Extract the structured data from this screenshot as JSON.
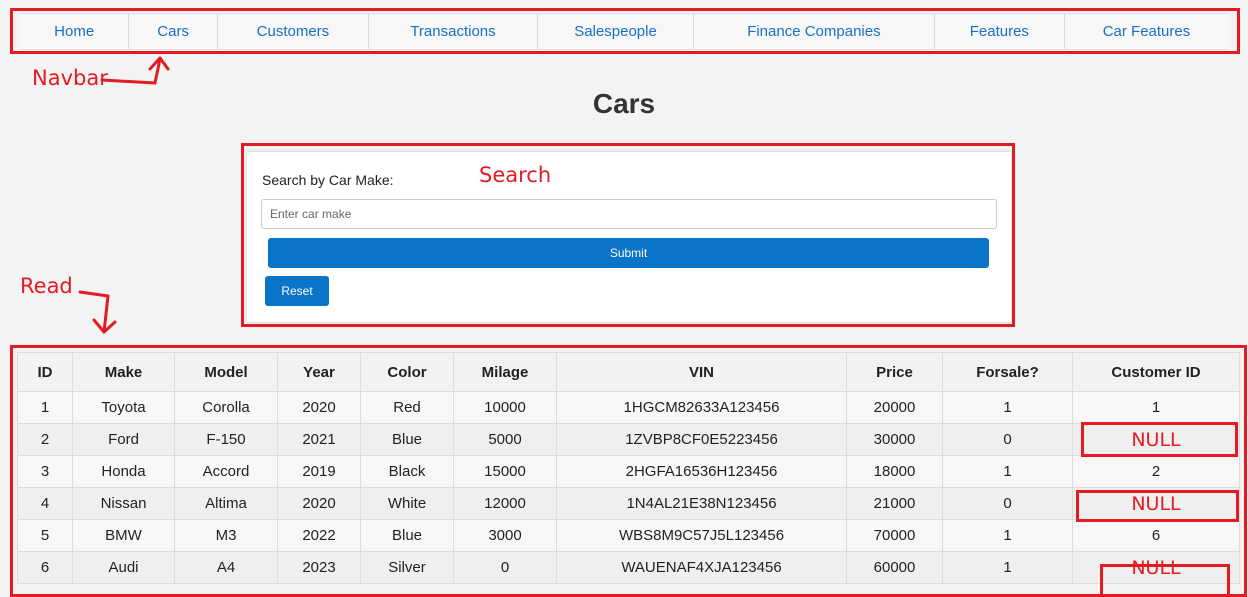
{
  "navbar": {
    "items": [
      {
        "label": "Home"
      },
      {
        "label": "Cars"
      },
      {
        "label": "Customers"
      },
      {
        "label": "Transactions"
      },
      {
        "label": "Salespeople"
      },
      {
        "label": "Finance Companies"
      },
      {
        "label": "Features"
      },
      {
        "label": "Car Features"
      }
    ]
  },
  "annotations": {
    "navbar": "Navbar",
    "search": "Search",
    "read": "Read",
    "null_label": "NULL",
    "color": "#e31b23"
  },
  "page": {
    "title": "Cars"
  },
  "search": {
    "label": "Search by Car Make:",
    "placeholder": "Enter car make",
    "submit_label": "Submit",
    "reset_label": "Reset"
  },
  "table": {
    "columns": [
      "ID",
      "Make",
      "Model",
      "Year",
      "Color",
      "Milage",
      "VIN",
      "Price",
      "Forsale?",
      "Customer ID"
    ],
    "rows": [
      [
        "1",
        "Toyota",
        "Corolla",
        "2020",
        "Red",
        "10000",
        "1HGCM82633A123456",
        "20000",
        "1",
        "1"
      ],
      [
        "2",
        "Ford",
        "F-150",
        "2021",
        "Blue",
        "5000",
        "1ZVBP8CF0E5223456",
        "30000",
        "0",
        "NULL"
      ],
      [
        "3",
        "Honda",
        "Accord",
        "2019",
        "Black",
        "15000",
        "2HGFA16536H123456",
        "18000",
        "1",
        "2"
      ],
      [
        "4",
        "Nissan",
        "Altima",
        "2020",
        "White",
        "12000",
        "1N4AL21E38N123456",
        "21000",
        "0",
        "NULL"
      ],
      [
        "5",
        "BMW",
        "M3",
        "2022",
        "Blue",
        "3000",
        "WBS8M9C57J5L123456",
        "70000",
        "1",
        "6"
      ],
      [
        "6",
        "Audi",
        "A4",
        "2023",
        "Silver",
        "0",
        "WAUENAF4XJA123456",
        "60000",
        "1",
        "NULL"
      ]
    ]
  },
  "colors": {
    "link": "#1a6fc4",
    "button": "#0a74c9",
    "annotation": "#e31b23"
  }
}
